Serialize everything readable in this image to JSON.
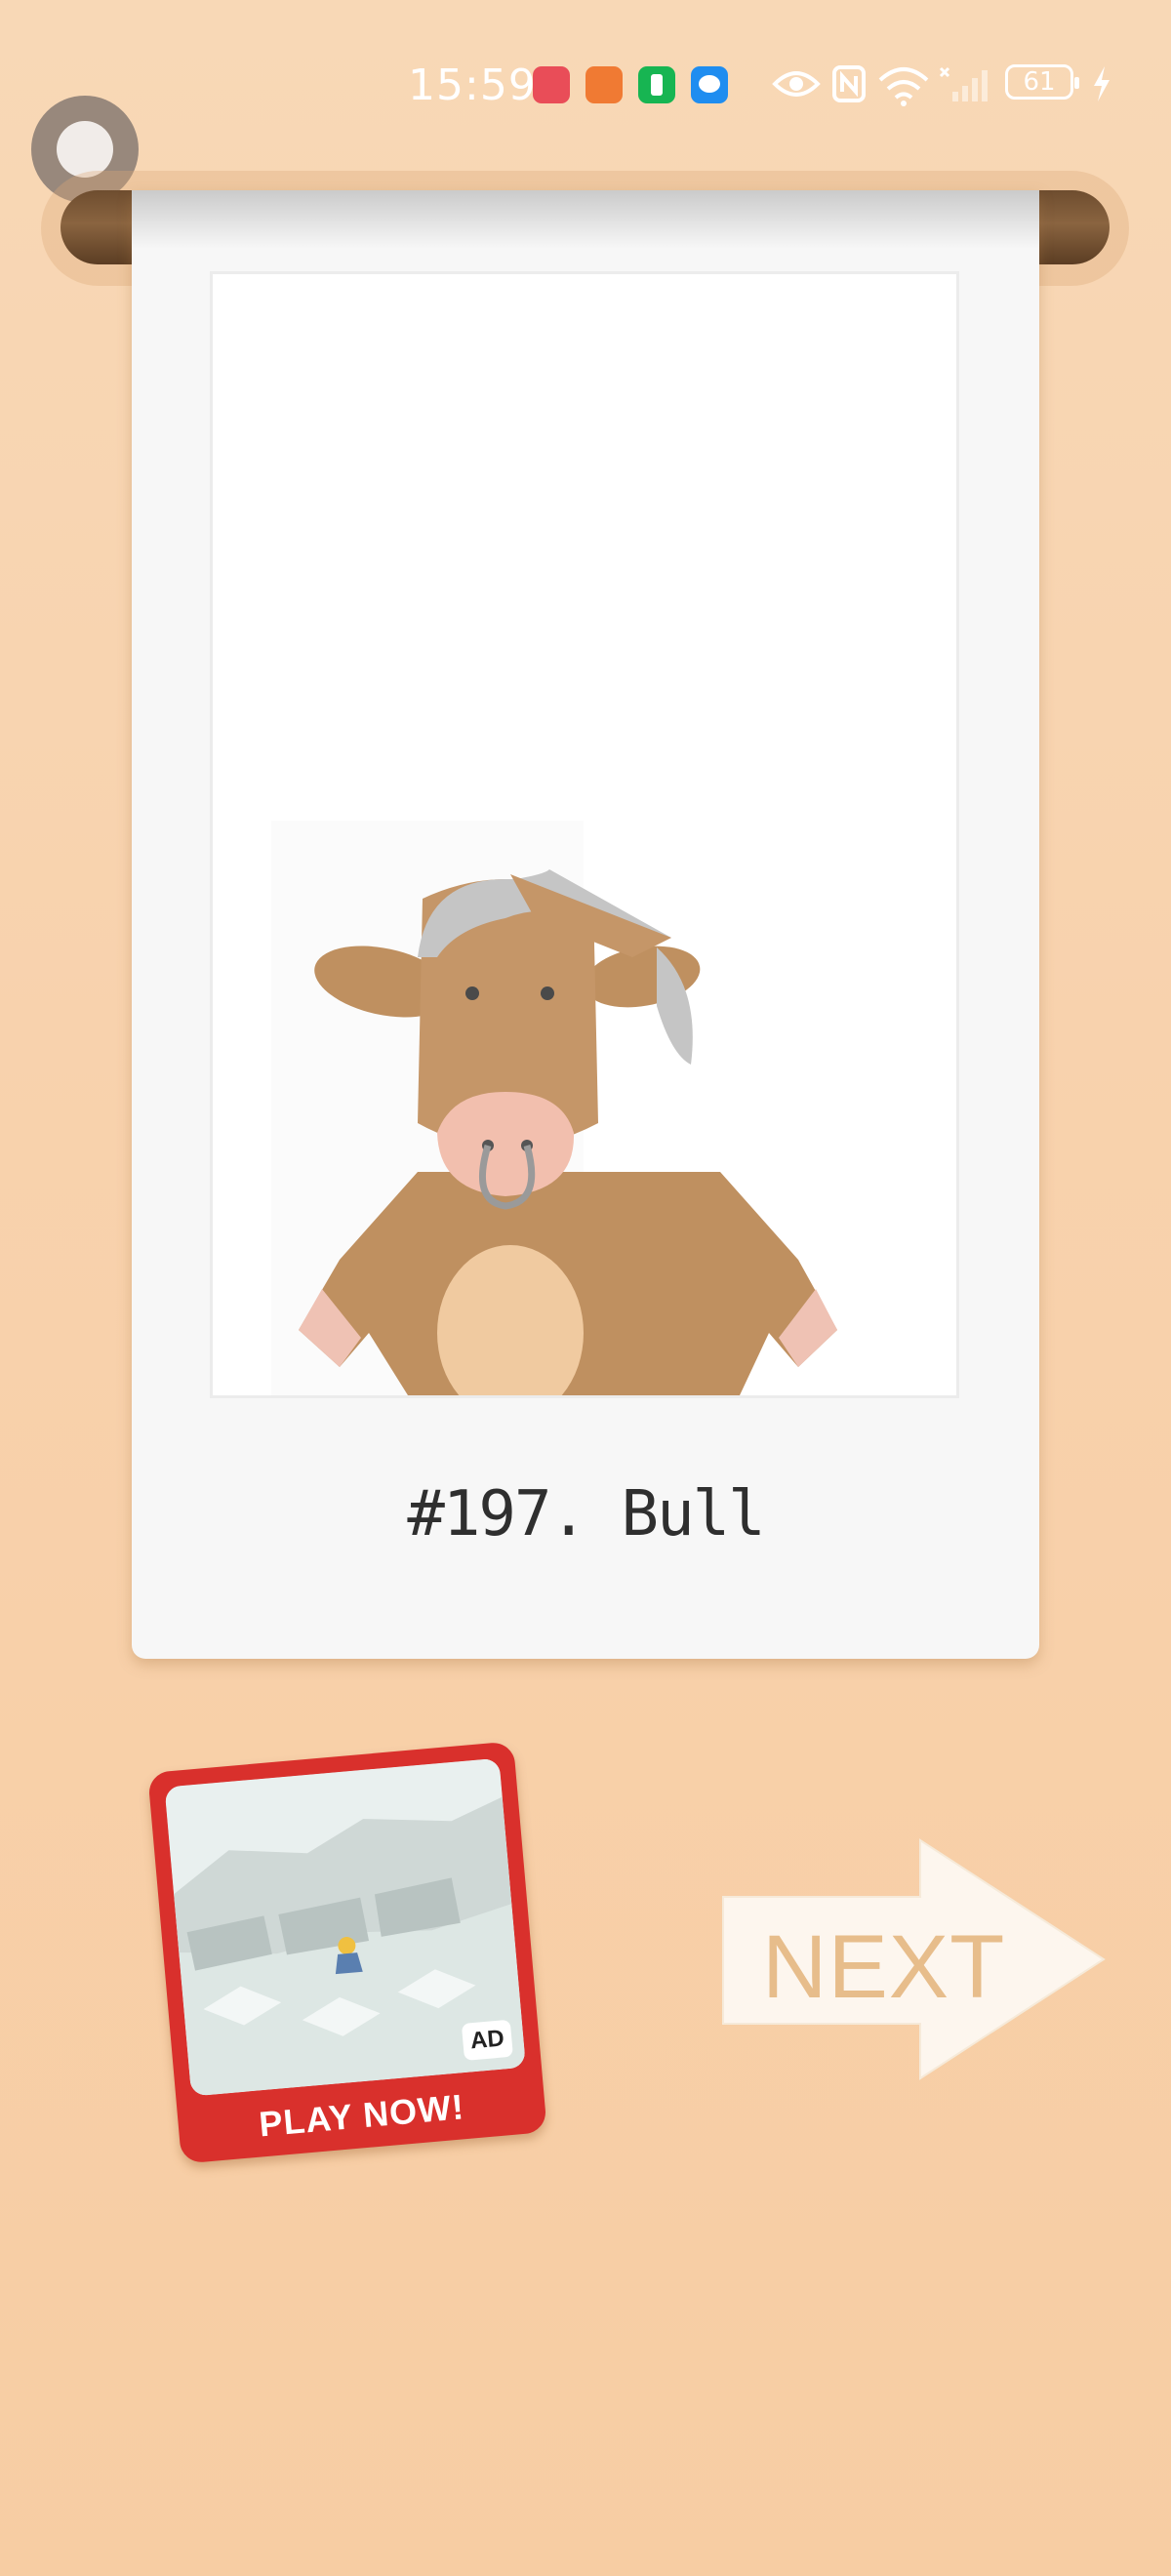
{
  "status_bar": {
    "time": "15:59",
    "battery": "61",
    "icons": [
      "huawei-store-icon",
      "video-app-icon",
      "phone-app-icon",
      "messages-icon",
      "eye-comfort-icon",
      "nfc-icon",
      "wifi-icon",
      "signal-icon",
      "battery-icon",
      "charging-icon"
    ]
  },
  "card": {
    "caption": "#197. Bull",
    "image": "bull-illustration"
  },
  "ad": {
    "badge": "AD",
    "cta": "PLAY NOW!"
  },
  "next_button": {
    "label": "NEXT"
  },
  "colors": {
    "background": "#f8d2ad",
    "rod": "#7a5534",
    "ad_frame": "#d9302c",
    "next_text": "#e7bd8b",
    "bull_body": "#bf9060",
    "bull_belly": "#f0caa0"
  }
}
